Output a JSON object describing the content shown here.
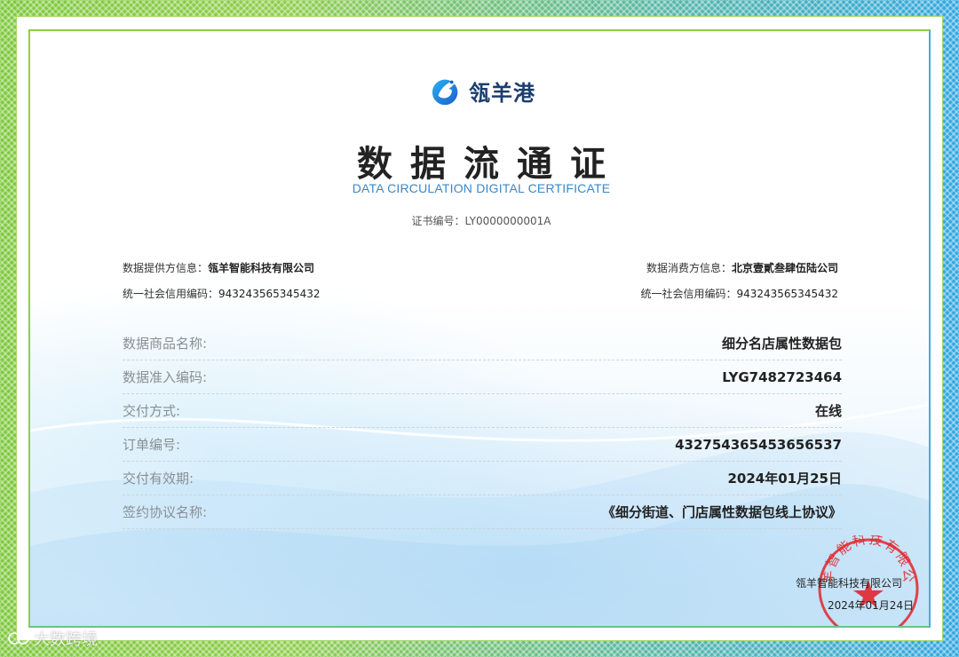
{
  "logo": {
    "text": "瓴羊港"
  },
  "title": "数据流通证",
  "subtitle": "DATA CIRCULATION DIGITAL CERTIFICATE",
  "certificate_no": {
    "label": "证书编号：",
    "value": "LY0000000001A"
  },
  "provider": {
    "info_label": "数据提供方信息：",
    "name": "瓴羊智能科技有限公司",
    "credit_label": "统一社会信用编码：",
    "credit_code": "943243565345432"
  },
  "consumer": {
    "info_label": "数据消费方信息：",
    "name": "北京壹貳叁肆伍陆公司",
    "credit_label": "统一社会信用编码：",
    "credit_code": "943243565345432"
  },
  "details": [
    {
      "label": "数据商品名称:",
      "value": "细分名店属性数据包"
    },
    {
      "label": "数据准入编码:",
      "value": "LYG7482723464"
    },
    {
      "label": "交付方式:",
      "value": "在线"
    },
    {
      "label": "订单编号:",
      "value": "432754365453656537"
    },
    {
      "label": "交付有效期:",
      "value": "2024年01月25日"
    },
    {
      "label": "签约协议名称:",
      "value": "《细分街道、门店属性数据包线上协议》"
    }
  ],
  "issuer": {
    "company": "瓴羊智能科技有限公司",
    "date": "2024年01月24日",
    "stamp_text": "瓴羊智能科技有限公司"
  },
  "watermark": {
    "text": "大数跨境"
  },
  "colors": {
    "frame_green": "#7cc83a",
    "frame_blue": "#2fa6e0",
    "subtitle_blue": "#3a88c8",
    "stamp_red": "#e0262b"
  }
}
